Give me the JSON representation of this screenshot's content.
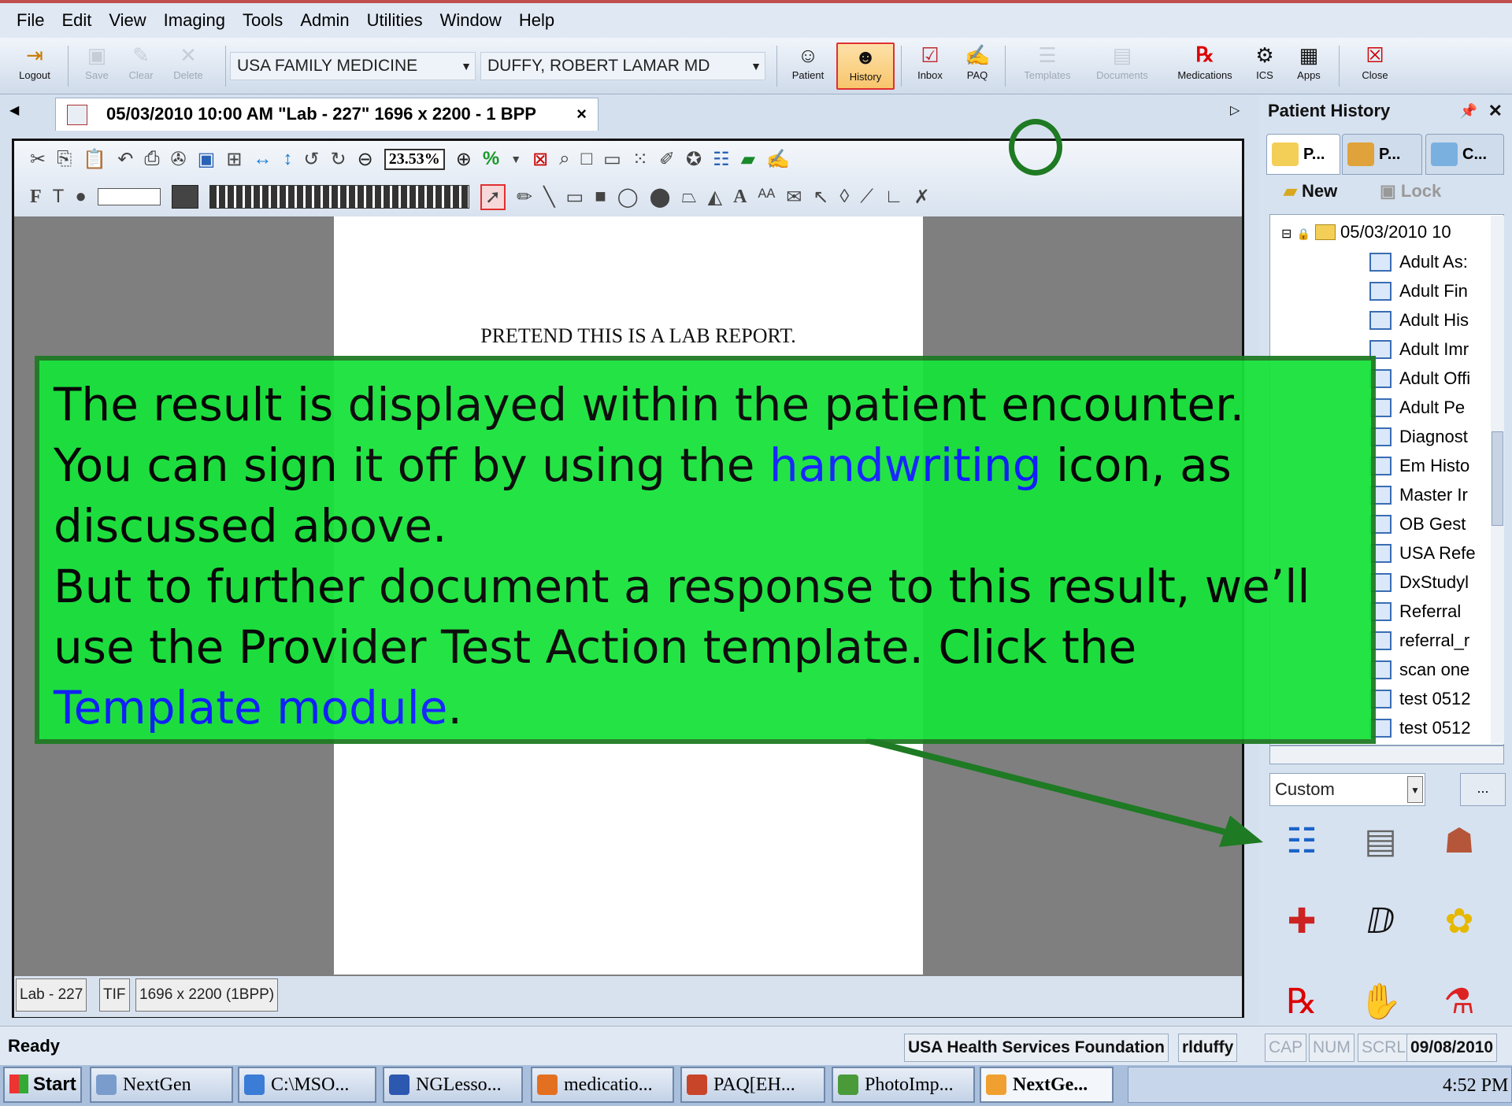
{
  "menu": [
    "File",
    "Edit",
    "View",
    "Imaging",
    "Tools",
    "Admin",
    "Utilities",
    "Window",
    "Help"
  ],
  "toolbar": {
    "logout": "Logout",
    "save": "Save",
    "clear": "Clear",
    "delete": "Delete",
    "practice": "USA FAMILY MEDICINE",
    "provider": "DUFFY, ROBERT  LAMAR MD",
    "patient": "Patient",
    "history": "History",
    "inbox": "Inbox",
    "paq": "PAQ",
    "templates": "Templates",
    "documents": "Documents",
    "medications": "Medications",
    "ics": "ICS",
    "apps": "Apps",
    "close": "Close"
  },
  "document_tab": {
    "title": "05/03/2010 10:00 AM \"Lab - 227\" 1696 x 2200 - 1 BPP",
    "close": "×"
  },
  "image_toolbar": {
    "zoom": "23.53%",
    "percent": "%"
  },
  "paper_text": "PRETEND THIS IS A LAB REPORT.",
  "image_status": {
    "name": "Lab - 227",
    "format": "TIF",
    "size": "1696 x 2200 (1BPP)"
  },
  "right_panel": {
    "title": "Patient History",
    "tabs": [
      "P...",
      "P...",
      "C..."
    ],
    "new": "New",
    "lock": "Lock",
    "tree_root": "05/03/2010 10",
    "tree_items": [
      "Adult As:",
      "Adult Fin",
      "Adult His",
      "Adult Imr",
      "Adult Offi",
      "Adult Pe",
      "Diagnost",
      "Em Histo",
      "Master Ir",
      "OB Gest",
      "USA Refe",
      "DxStudyl",
      "Referral",
      "referral_r",
      "scan one",
      "test 0512",
      "test 0512"
    ],
    "filter": "Custom",
    "filter_btn": "..."
  },
  "status_bar": {
    "ready": "Ready",
    "org": "USA Health Services Foundation",
    "user": "rlduffy",
    "cap": "CAP",
    "num": "NUM",
    "scrl": "SCRL",
    "date": "09/08/2010"
  },
  "taskbar": {
    "start": "Start",
    "items": [
      "NextGen",
      "C:\\MSO...",
      "NGLesso...",
      "medicatio...",
      "PAQ[EH...",
      "PhotoImp...",
      "NextGe..."
    ],
    "clock": "4:52 PM"
  },
  "callout": {
    "line1": "The result is displayed within the patient encounter.",
    "line2a": "You can sign it off by using the ",
    "line2b": "handwriting",
    "line2c": " icon, as",
    "line3": "discussed above.",
    "line4": "But to further document a response to this result, we’ll",
    "line5": "use the Provider Test Action template.  Click the",
    "line6a": "Template module",
    "line6b": "."
  },
  "colors": {
    "callout_bg": "#17e33a",
    "callout_border": "#1e7a23",
    "highlight_text": "#0b1bff",
    "active_button_border": "#e03030"
  },
  "icons": [
    "logout-icon",
    "save-icon",
    "clear-icon",
    "delete-icon",
    "patient-icon",
    "history-icon",
    "inbox-icon",
    "paq-icon",
    "templates-icon",
    "documents-icon",
    "medications-icon",
    "ics-icon",
    "apps-icon",
    "close-icon",
    "handwriting-icon",
    "template-module-icon",
    "document-module-icon",
    "image-module-icon",
    "procedure-module-icon",
    "diagnosis-module-icon",
    "allergy-module-icon",
    "rx-module-icon",
    "order-module-icon",
    "lab-module-icon"
  ]
}
